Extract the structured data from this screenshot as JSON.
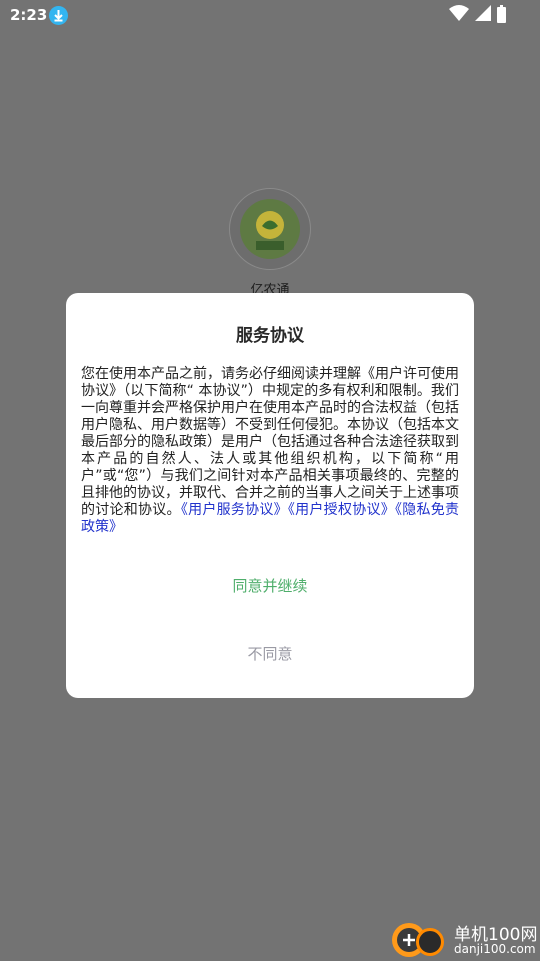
{
  "status_bar": {
    "time": "2:23"
  },
  "app": {
    "name": "亿农通",
    "logo_text": "亿农通"
  },
  "dialog": {
    "title": "服务协议",
    "body_text": "您在使用本产品之前，请务必仔细阅读并理解《用户许可使用协议》（以下简称“ 本协议”）中规定的多有权利和限制。我们一向尊重并会严格保护用户在使用本产品时的合法权益（包括用户隐私、用户数据等）不受到任何侵犯。本协议（包括本文最后部分的隐私政策）是用户（包括通过各种合法途径获取到本产品的自然人、法人或其他组织机构，以下简称“用户”或“您”）与我们之间针对本产品相关事项最终的、完整的且排他的协议，并取代、合并之前的当事人之间关于上述事项的讨论和协议。",
    "links": {
      "service_agreement": "《用户服务协议》",
      "auth_agreement": "《用户授权协议》",
      "privacy_policy": "《隐私免责政策》"
    },
    "agree_label": "同意并继续",
    "disagree_label": "不同意"
  },
  "watermark": {
    "title": "单机100网",
    "url": "danji100.com"
  },
  "colors": {
    "overlay": "#737373",
    "agree": "#4fae6b",
    "disagree": "#9a9aa4",
    "link": "#2233cc"
  }
}
